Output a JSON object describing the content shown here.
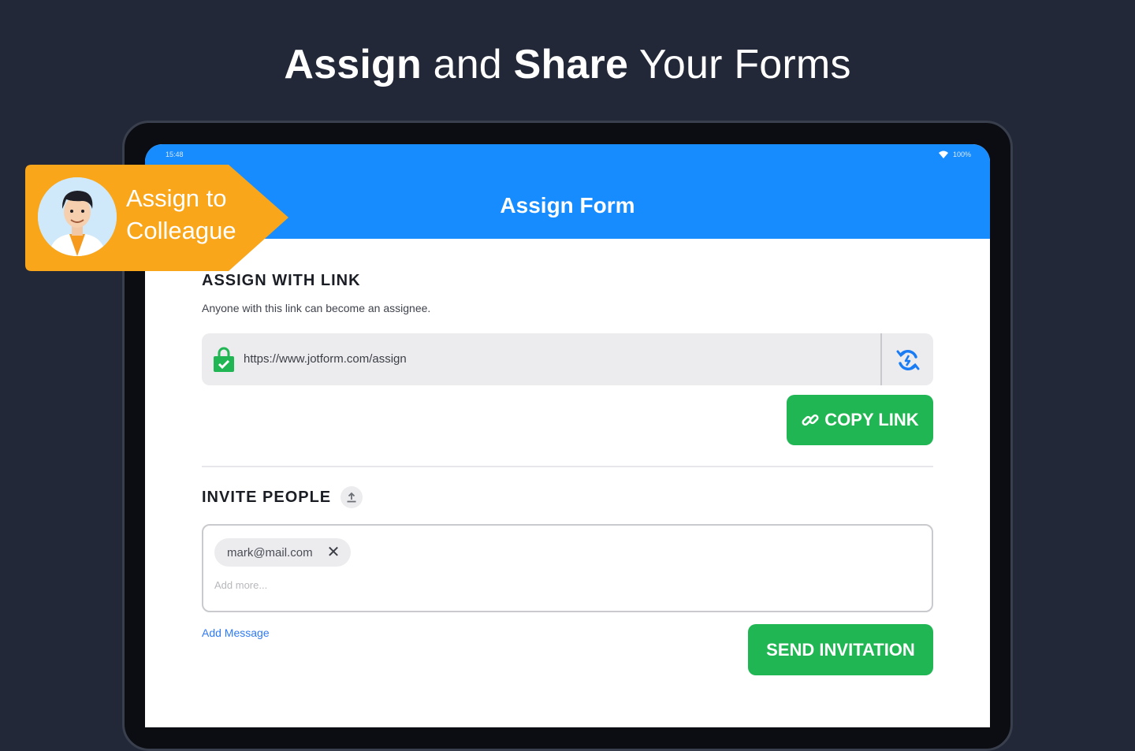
{
  "headline": {
    "part1": "Assign",
    "part2": " and ",
    "part3": "Share",
    "part4": " Your Forms"
  },
  "badge": {
    "line1": "Assign to",
    "line2": "Colleague"
  },
  "status_bar": {
    "time": "15:48",
    "battery": "100%"
  },
  "appbar": {
    "title": "Assign Form"
  },
  "assign_with_link": {
    "title": "ASSIGN WITH LINK",
    "subtitle": "Anyone with this link can become an assignee.",
    "url": "https://www.jotform.com/assign",
    "copy_label": "COPY LINK"
  },
  "invite_people": {
    "title": "INVITE PEOPLE",
    "chips": [
      "mark@mail.com"
    ],
    "placeholder": "Add more...",
    "add_message": "Add Message",
    "send_label": "SEND INVITATION"
  },
  "colors": {
    "background": "#232838",
    "appbar": "#168cff",
    "accent_green": "#20b653",
    "badge": "#f9a61b"
  },
  "icons": [
    "lock-icon",
    "refresh-icon",
    "link-icon",
    "upload-icon",
    "close-icon",
    "wifi-icon"
  ]
}
